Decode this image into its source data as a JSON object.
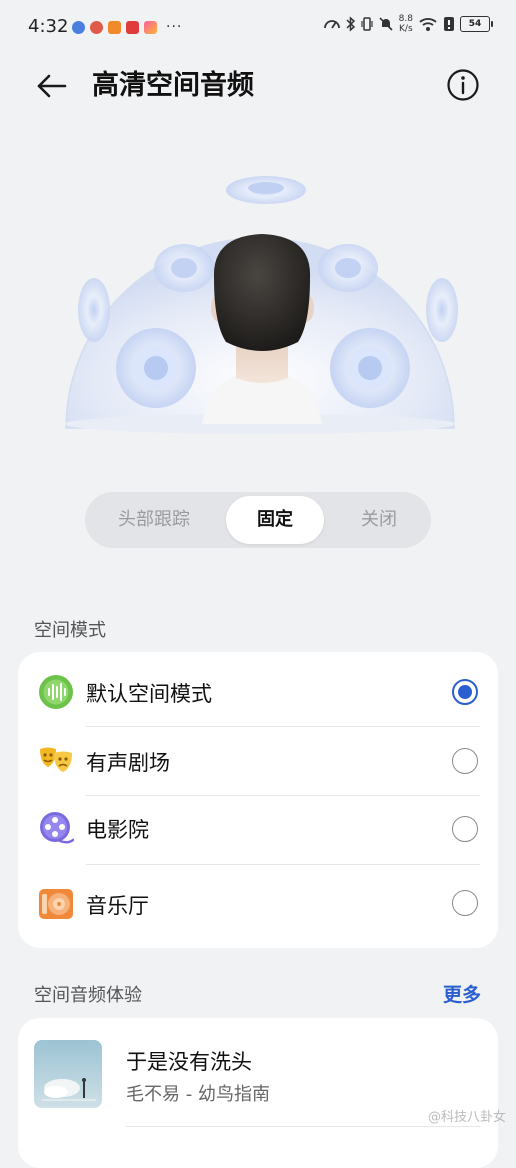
{
  "status_bar": {
    "time": "4:32",
    "more": "···",
    "net_speed_value": "8.8",
    "net_speed_unit": "K/s",
    "battery": "54"
  },
  "header": {
    "title": "高清空间音频"
  },
  "modes_toggle": {
    "options": [
      "头部跟踪",
      "固定",
      "关闭"
    ],
    "selected": "固定"
  },
  "spatial_mode": {
    "heading": "空间模式",
    "items": [
      {
        "label": "默认空间模式",
        "icon": "waveform-icon",
        "checked": true
      },
      {
        "label": "有声剧场",
        "icon": "theater-masks-icon",
        "checked": false
      },
      {
        "label": "电影院",
        "icon": "film-reel-icon",
        "checked": false
      },
      {
        "label": "音乐厅",
        "icon": "music-hall-icon",
        "checked": false
      }
    ]
  },
  "experience": {
    "heading": "空间音频体验",
    "more": "更多",
    "song": {
      "title": "于是没有洗头",
      "subtitle": "毛不易 - 幼鸟指南"
    }
  },
  "watermark": "@科技八卦女",
  "colors": {
    "accent": "#2b5fcf",
    "background": "#f1f2f4",
    "card": "#ffffff"
  }
}
